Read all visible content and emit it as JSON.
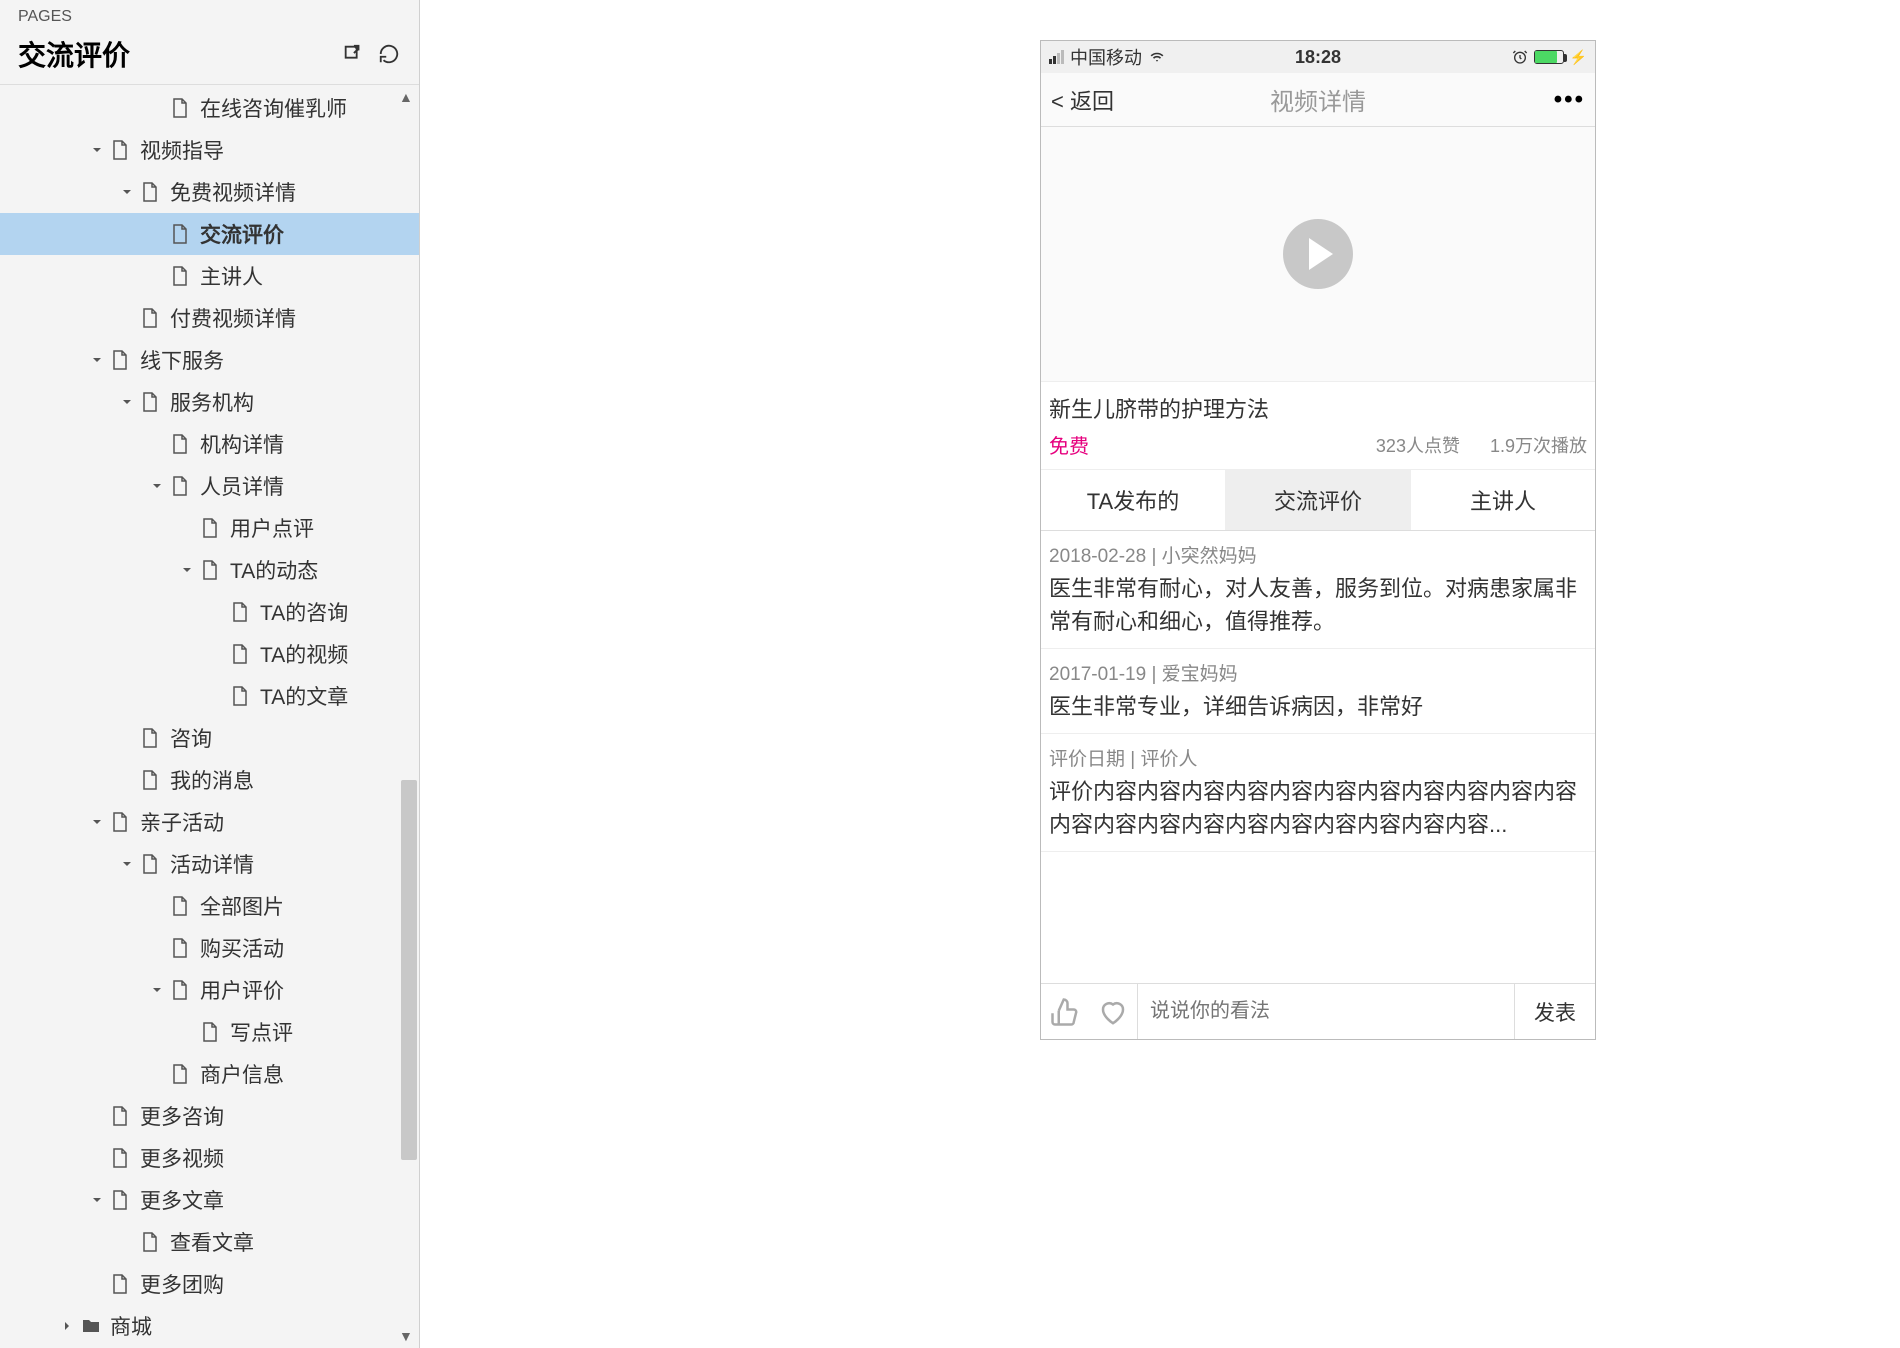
{
  "sidebar": {
    "pages_label": "PAGES",
    "title": "交流评价",
    "items": [
      {
        "label": "在线咨询催乳师",
        "indent": 5,
        "caret": "",
        "icon": "page"
      },
      {
        "label": "视频指导",
        "indent": 3,
        "caret": "down",
        "icon": "page"
      },
      {
        "label": "免费视频详情",
        "indent": 4,
        "caret": "down",
        "icon": "page"
      },
      {
        "label": "交流评价",
        "indent": 5,
        "caret": "",
        "icon": "page",
        "active": true
      },
      {
        "label": "主讲人",
        "indent": 5,
        "caret": "",
        "icon": "page"
      },
      {
        "label": "付费视频详情",
        "indent": 4,
        "caret": "",
        "icon": "page"
      },
      {
        "label": "线下服务",
        "indent": 3,
        "caret": "down",
        "icon": "page"
      },
      {
        "label": "服务机构",
        "indent": 4,
        "caret": "down",
        "icon": "page"
      },
      {
        "label": "机构详情",
        "indent": 5,
        "caret": "",
        "icon": "page"
      },
      {
        "label": "人员详情",
        "indent": 5,
        "caret": "down",
        "icon": "page"
      },
      {
        "label": "用户点评",
        "indent": 6,
        "caret": "",
        "icon": "page"
      },
      {
        "label": "TA的动态",
        "indent": 6,
        "caret": "down",
        "icon": "page"
      },
      {
        "label": "TA的咨询",
        "indent": 7,
        "caret": "",
        "icon": "page"
      },
      {
        "label": "TA的视频",
        "indent": 7,
        "caret": "",
        "icon": "page"
      },
      {
        "label": "TA的文章",
        "indent": 7,
        "caret": "",
        "icon": "page"
      },
      {
        "label": "咨询",
        "indent": 4,
        "caret": "",
        "icon": "page"
      },
      {
        "label": "我的消息",
        "indent": 4,
        "caret": "",
        "icon": "page"
      },
      {
        "label": "亲子活动",
        "indent": 3,
        "caret": "down",
        "icon": "page"
      },
      {
        "label": "活动详情",
        "indent": 4,
        "caret": "down",
        "icon": "page"
      },
      {
        "label": "全部图片",
        "indent": 5,
        "caret": "",
        "icon": "page"
      },
      {
        "label": "购买活动",
        "indent": 5,
        "caret": "",
        "icon": "page"
      },
      {
        "label": "用户评价",
        "indent": 5,
        "caret": "down",
        "icon": "page"
      },
      {
        "label": "写点评",
        "indent": 6,
        "caret": "",
        "icon": "page"
      },
      {
        "label": "商户信息",
        "indent": 5,
        "caret": "",
        "icon": "page"
      },
      {
        "label": "更多咨询",
        "indent": 3,
        "caret": "",
        "icon": "page"
      },
      {
        "label": "更多视频",
        "indent": 3,
        "caret": "",
        "icon": "page"
      },
      {
        "label": "更多文章",
        "indent": 3,
        "caret": "down",
        "icon": "page"
      },
      {
        "label": "查看文章",
        "indent": 4,
        "caret": "",
        "icon": "page"
      },
      {
        "label": "更多团购",
        "indent": 3,
        "caret": "",
        "icon": "page"
      },
      {
        "label": "商城",
        "indent": 2,
        "caret": "right",
        "icon": "folder"
      }
    ]
  },
  "phone": {
    "statusbar": {
      "carrier": "中国移动",
      "time": "18:28"
    },
    "navbar": {
      "back": "< 返回",
      "title": "视频详情",
      "more": "•••"
    },
    "video": {
      "title": "新生儿脐带的护理方法",
      "free": "免费",
      "likes": "323人点赞",
      "plays": "1.9万次播放"
    },
    "tabs": [
      {
        "label": "TA发布的"
      },
      {
        "label": "交流评价",
        "active": true
      },
      {
        "label": "主讲人"
      }
    ],
    "reviews": [
      {
        "meta": "2018-02-28 | 小突然妈妈",
        "text": "医生非常有耐心，对人友善，服务到位。对病患家属非常有耐心和细心，值得推荐。"
      },
      {
        "meta": "2017-01-19 | 爱宝妈妈",
        "text": "医生非常专业，详细告诉病因，非常好"
      },
      {
        "meta": "评价日期 | 评价人",
        "text": "评价内容内容内容内容内容内容内容内容内容内容内容内容内容内容内容内容内容内容内容内容内容..."
      }
    ],
    "footer": {
      "placeholder": "说说你的看法",
      "publish": "发表"
    }
  }
}
